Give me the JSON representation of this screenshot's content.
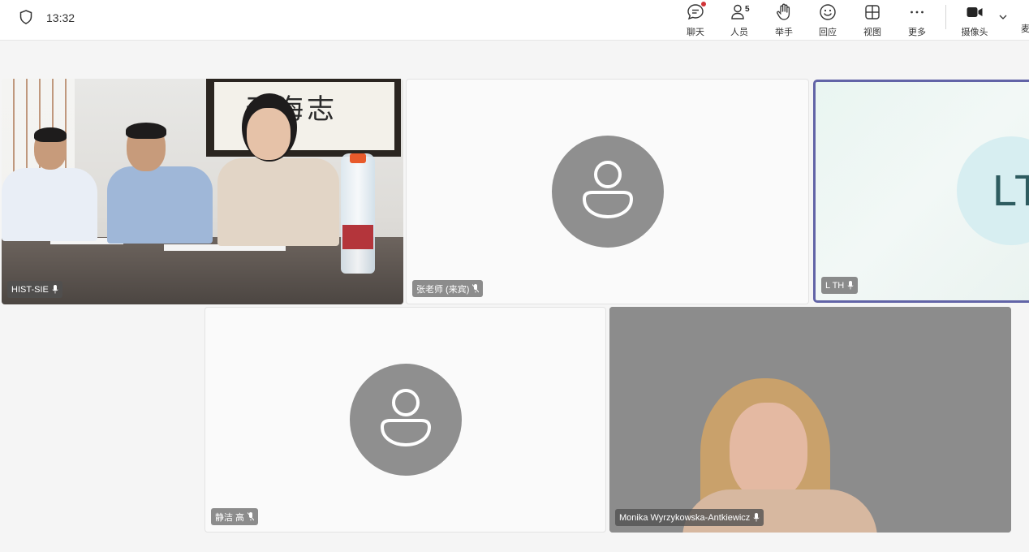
{
  "status": {
    "time": "13:32"
  },
  "toolbar": {
    "chat_label": "聊天",
    "people_label": "人员",
    "people_count": "5",
    "hand_label": "举手",
    "react_label": "回应",
    "view_label": "视图",
    "more_label": "更多",
    "camera_label": "摄像头",
    "clipped_label": "麦"
  },
  "tiles": [
    {
      "name": "HIST-SIE",
      "type": "video"
    },
    {
      "name": "张老师 (来宾)",
      "type": "avatar",
      "muted": true
    },
    {
      "name": "L TH",
      "type": "initials",
      "initials": "LT",
      "active_speaker": true
    },
    {
      "name": "静洁 高",
      "type": "avatar",
      "muted": true
    },
    {
      "name": "Monika Wyrzykowska-Antkiewicz",
      "type": "video"
    }
  ],
  "scene": {
    "calligraphy": "天海志"
  },
  "colors": {
    "active_border": "#6264a7",
    "notification_dot": "#d13438"
  }
}
